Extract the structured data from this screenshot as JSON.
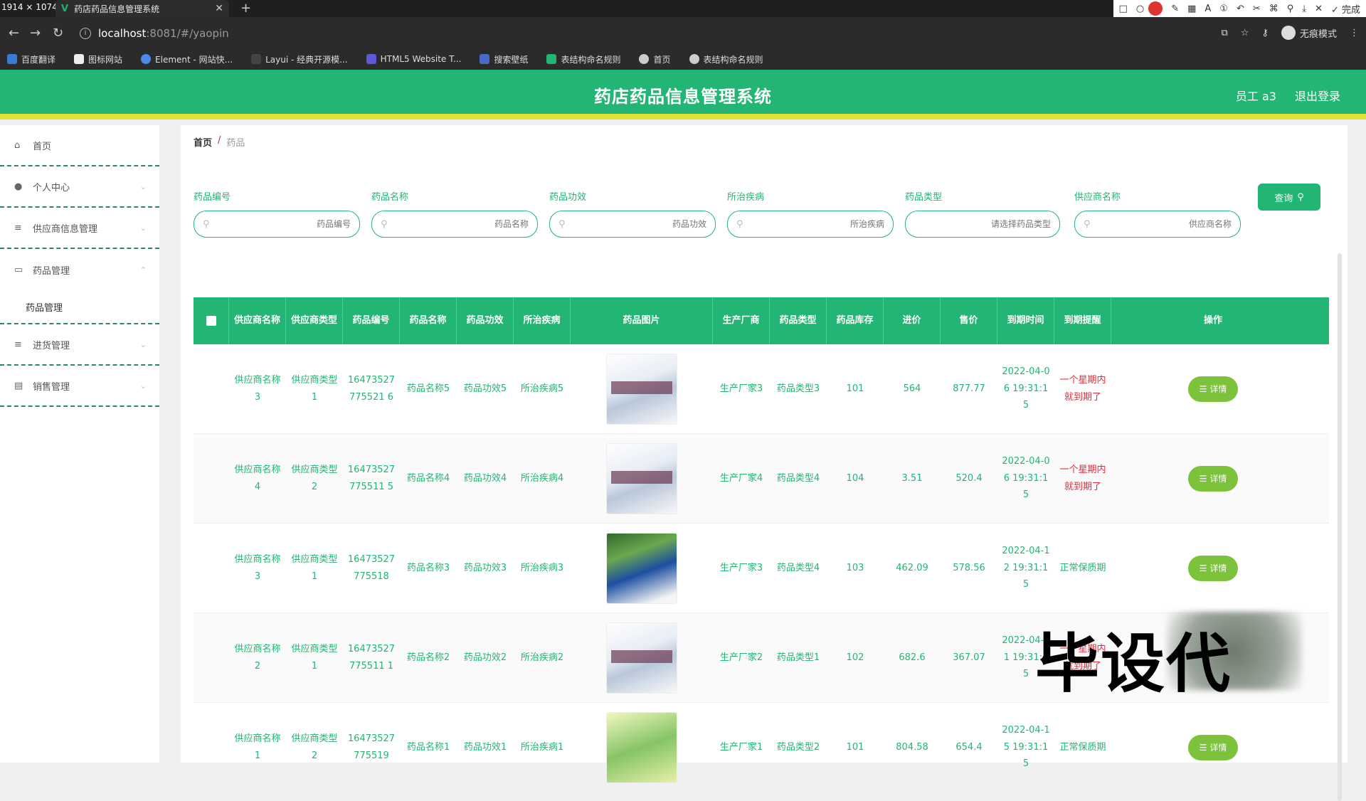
{
  "browser": {
    "dims": "1914 × 1074",
    "tab_title": "药店药品信息管理系统",
    "url_host": "localhost",
    "url_path": ":8081/#/yaopin",
    "incognito": "无痕模式",
    "toolstrip_done": "完成",
    "bookmarks": [
      "百度翻译",
      "图标网站",
      "Element - 网站快...",
      "Layui - 经典开源模...",
      "HTML5 Website T...",
      "搜索壁纸",
      "表结构命名规则",
      "首页",
      "表结构命名规则"
    ]
  },
  "header": {
    "title": "药店药品信息管理系统",
    "user": "员工 a3",
    "logout": "退出登录"
  },
  "sidebar": {
    "items": [
      {
        "label": "首页",
        "icon": "home-icon"
      },
      {
        "label": "个人中心",
        "icon": "user-icon"
      },
      {
        "label": "供应商信息管理",
        "icon": "menu-icon"
      },
      {
        "label": "药品管理",
        "icon": "calendar-icon"
      },
      {
        "label": "进货管理",
        "icon": "menu-icon"
      },
      {
        "label": "销售管理",
        "icon": "chat-icon"
      }
    ],
    "sub_item": "药品管理"
  },
  "breadcrumb": {
    "home": "首页",
    "separator": "/",
    "current": "药品"
  },
  "filters": [
    {
      "label": "药品编号",
      "placeholder": "药品编号"
    },
    {
      "label": "药品名称",
      "placeholder": "药品名称"
    },
    {
      "label": "药品功效",
      "placeholder": "药品功效"
    },
    {
      "label": "所治疾病",
      "placeholder": "所治疾病"
    },
    {
      "label": "药品类型",
      "placeholder": "请选择药品类型"
    },
    {
      "label": "供应商名称",
      "placeholder": "供应商名称"
    }
  ],
  "search_button": "查询",
  "table": {
    "headers": [
      "供应商名称",
      "供应商类型",
      "药品编号",
      "药品名称",
      "药品功效",
      "所治疾病",
      "药品图片",
      "生产厂商",
      "药品类型",
      "药品库存",
      "进价",
      "售价",
      "到期时间",
      "到期提醒",
      "操作"
    ],
    "detail_label": "详情",
    "rows": [
      {
        "supplier": "供应商名称3",
        "stype": "供应商类型1",
        "code": "16473527775521 6",
        "name": "药品名称5",
        "effect": "药品功效5",
        "disease": "所治疾病5",
        "maker": "生产厂家3",
        "dtype": "药品类型3",
        "stock": "101",
        "cost": "564",
        "price": "877.77",
        "expire": "2022-04-06 19:31:15",
        "remind": "一个星期内就到期了",
        "warn": true,
        "img": "box"
      },
      {
        "supplier": "供应商名称4",
        "stype": "供应商类型2",
        "code": "16473527775511 5",
        "name": "药品名称4",
        "effect": "药品功效4",
        "disease": "所治疾病4",
        "maker": "生产厂家4",
        "dtype": "药品类型4",
        "stock": "104",
        "cost": "3.51",
        "price": "520.4",
        "expire": "2022-04-06 19:31:15",
        "remind": "一个星期内就到期了",
        "warn": true,
        "img": "box"
      },
      {
        "supplier": "供应商名称3",
        "stype": "供应商类型1",
        "code": "16473527775518",
        "name": "药品名称3",
        "effect": "药品功效3",
        "disease": "所治疾病3",
        "maker": "生产厂家3",
        "dtype": "药品类型4",
        "stock": "103",
        "cost": "462.09",
        "price": "578.56",
        "expire": "2022-04-12 19:31:15",
        "remind": "正常保质期",
        "warn": false,
        "img": "green"
      },
      {
        "supplier": "供应商名称2",
        "stype": "供应商类型1",
        "code": "16473527775511 1",
        "name": "药品名称2",
        "effect": "药品功效2",
        "disease": "所治疾病2",
        "maker": "生产厂家2",
        "dtype": "药品类型1",
        "stock": "102",
        "cost": "682.6",
        "price": "367.07",
        "expire": "2022-04-11 19:31:15",
        "remind": "一个星期内就到期了",
        "warn": true,
        "img": "box"
      },
      {
        "supplier": "供应商名称1",
        "stype": "供应商类型2",
        "code": "16473527775519",
        "name": "药品名称1",
        "effect": "药品功效1",
        "disease": "所治疾病1",
        "maker": "生产厂家1",
        "dtype": "药品类型2",
        "stock": "101",
        "cost": "804.58",
        "price": "654.4",
        "expire": "2022-04-15 19:31:15",
        "remind": "正常保质期",
        "warn": false,
        "img": "yellow"
      }
    ]
  },
  "watermark": "毕设代",
  "colors": {
    "primary": "#22b573",
    "accent_bar": "#e2e234",
    "warn": "#e02a3c",
    "detail_btn": "#7cc23a"
  }
}
